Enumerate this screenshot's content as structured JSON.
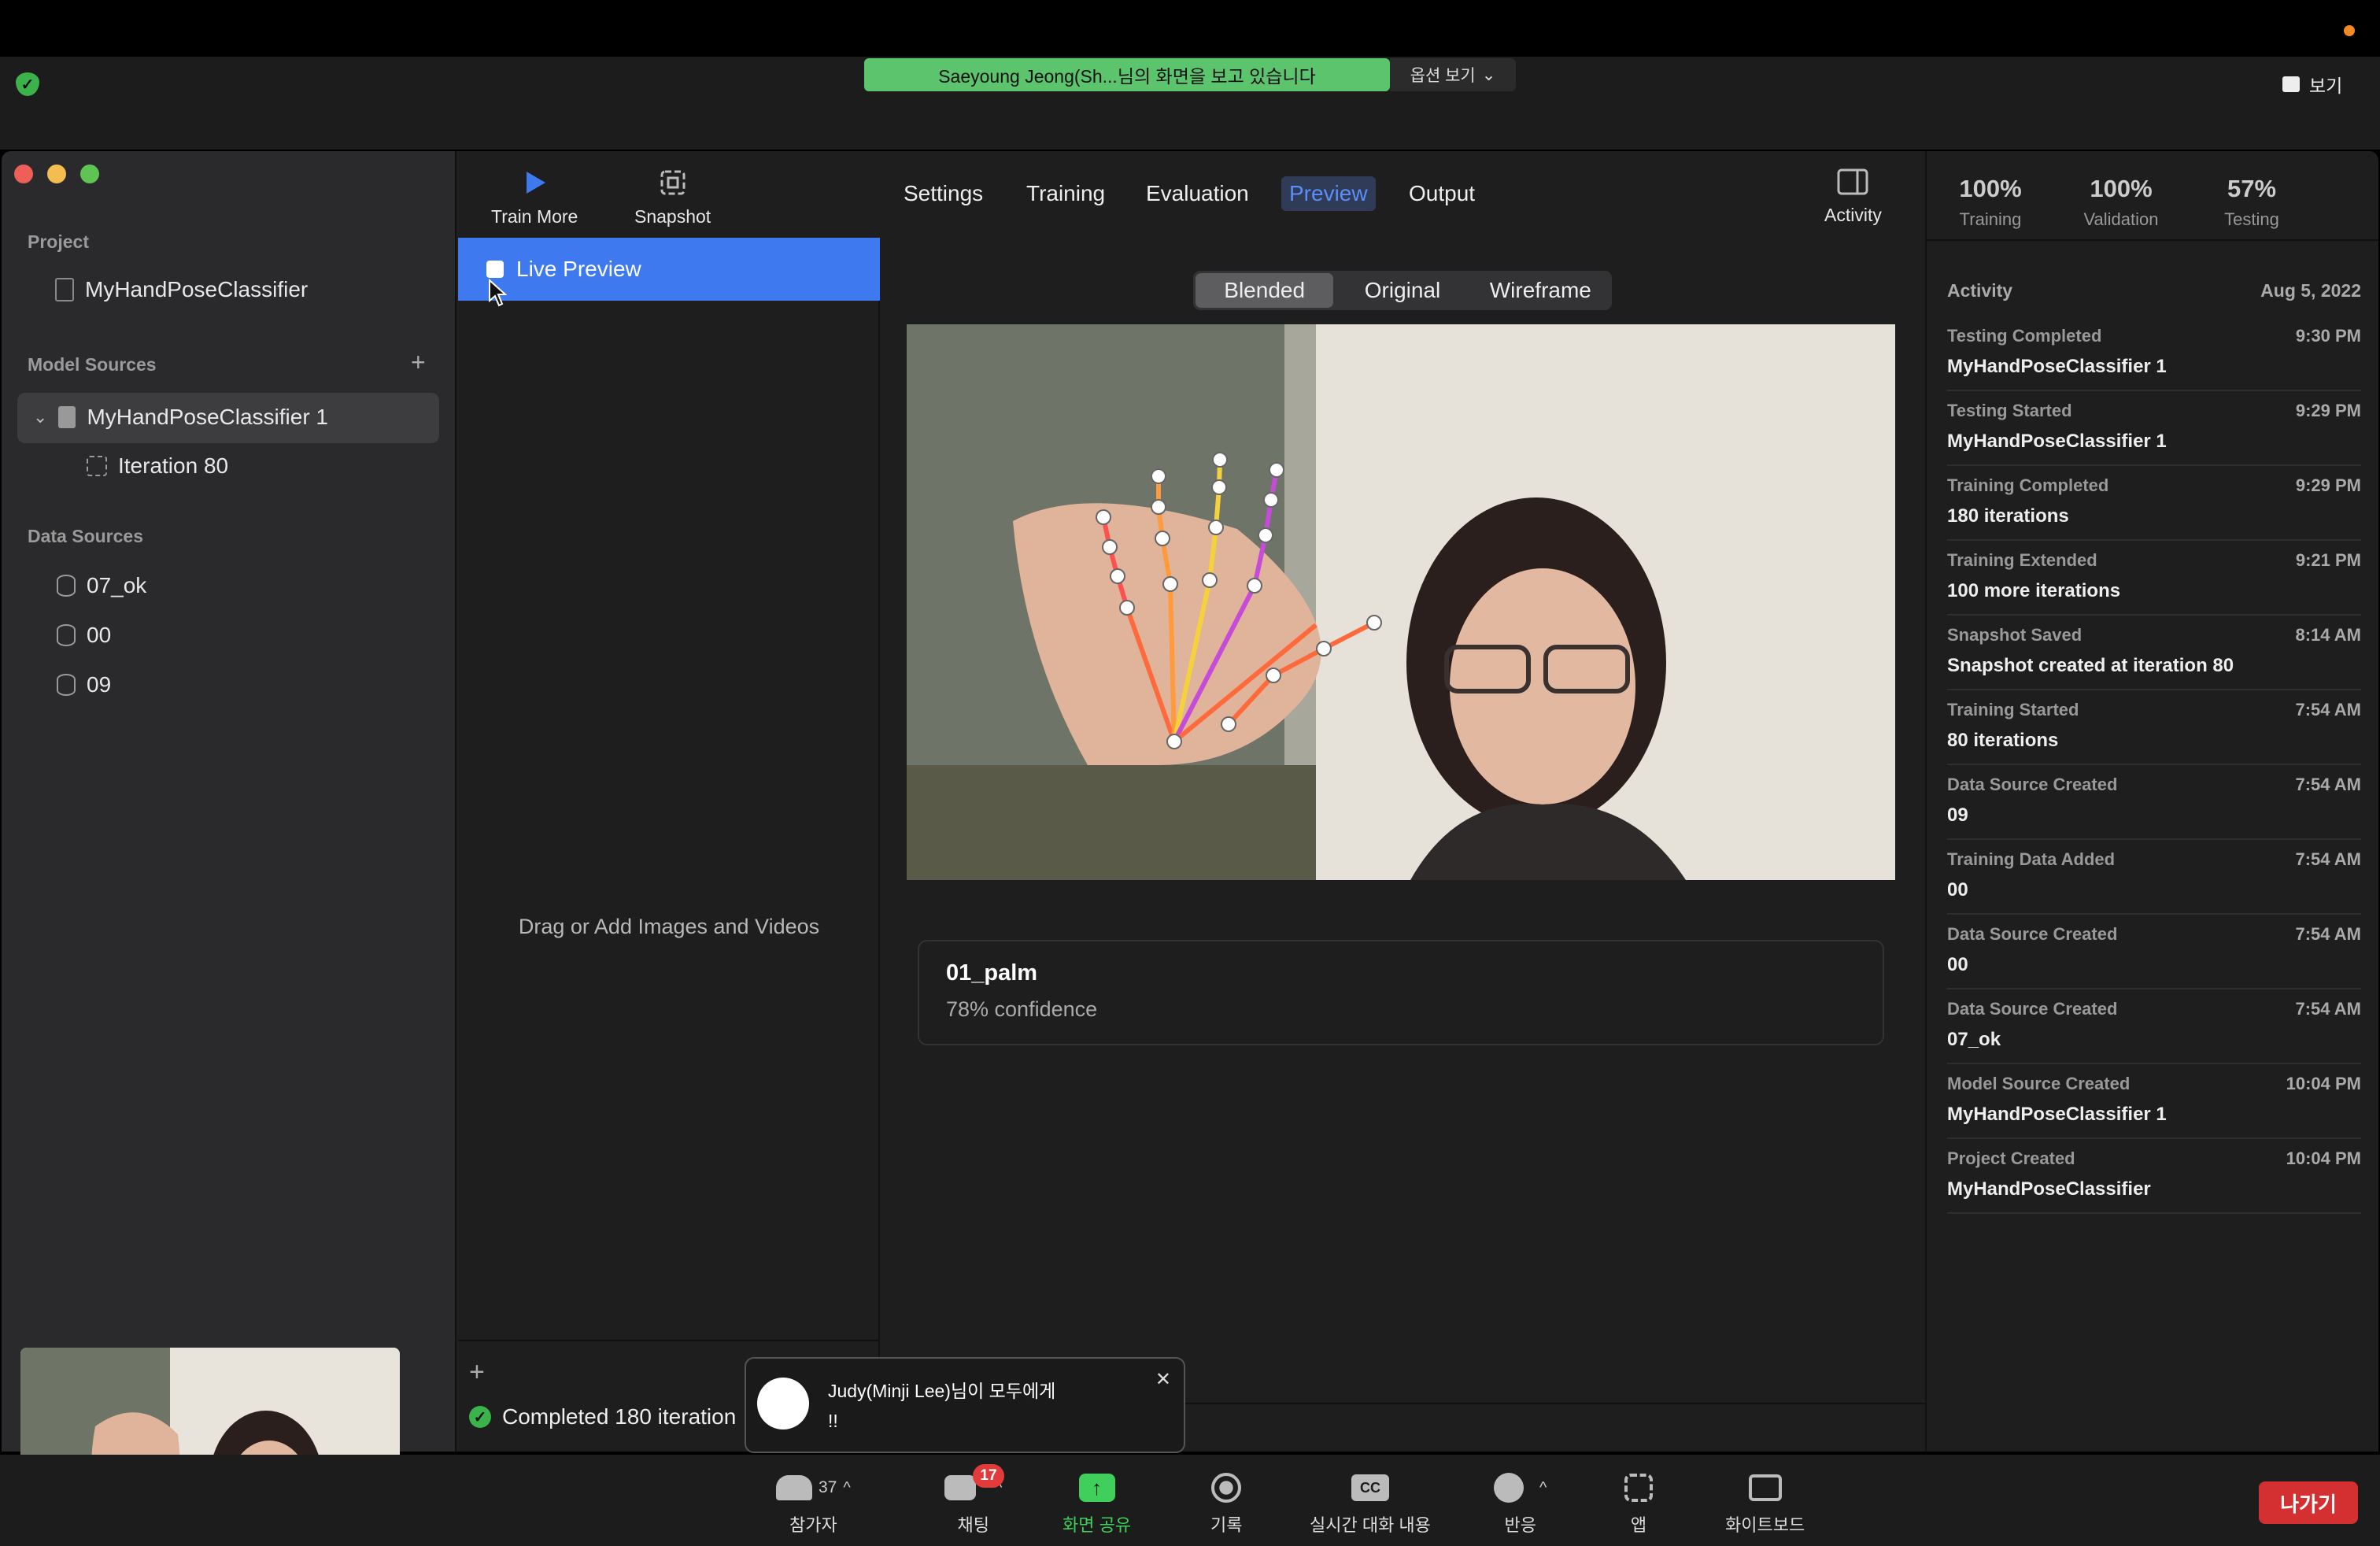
{
  "zoom": {
    "share_banner": "Saeyoung Jeong(Sh...님의 화면을 보고 있습니다",
    "view_options": "옵션 보기",
    "view_button": "보기",
    "chat_toast": {
      "sender": "Judy(Minji Lee)님이 모두에게",
      "message": "!!"
    },
    "bottom_bar": {
      "participants_label": "참가자",
      "participants_count": "37",
      "chat_label": "채팅",
      "chat_badge": "17",
      "share_label": "화면 공유",
      "record_label": "기록",
      "captions_label": "실시간 대화 내용",
      "captions_icon_text": "CC",
      "reactions_label": "반응",
      "apps_label": "앱",
      "whiteboard_label": "화이트보드",
      "leave_label": "나가기"
    },
    "colors": {
      "share_banner": "#5cc46c",
      "leave": "#d43031",
      "share_green": "#3fcf5a"
    }
  },
  "sidebar": {
    "project_heading": "Project",
    "project_name": "MyHandPoseClassifier",
    "model_sources_heading": "Model Sources",
    "model_source": "MyHandPoseClassifier 1",
    "iteration": "Iteration 80",
    "data_sources_heading": "Data Sources",
    "data_sources": [
      "07_ok",
      "00",
      "09"
    ]
  },
  "toolbar": {
    "train_more": "Train More",
    "snapshot": "Snapshot",
    "activity": "Activity",
    "tabs": [
      "Settings",
      "Training",
      "Evaluation",
      "Preview",
      "Output"
    ],
    "selected_tab": "Preview"
  },
  "list": {
    "live_preview": "Live Preview",
    "drag_hint": "Drag or Add Images and Videos",
    "add_icon": "+",
    "status": "Completed 180 iteration"
  },
  "preview": {
    "modes": [
      "Blended",
      "Original",
      "Wireframe"
    ],
    "selected_mode": "Blended",
    "prediction_label": "01_palm",
    "prediction_confidence": "78% confidence"
  },
  "stats": [
    {
      "value": "100%",
      "label": "Training"
    },
    {
      "value": "100%",
      "label": "Validation"
    },
    {
      "value": "57%",
      "label": "Testing"
    }
  ],
  "activity": {
    "heading": "Activity",
    "date": "Aug 5, 2022",
    "items": [
      {
        "title": "Testing Completed",
        "time": "9:30 PM",
        "detail": "MyHandPoseClassifier 1"
      },
      {
        "title": "Testing Started",
        "time": "9:29 PM",
        "detail": "MyHandPoseClassifier 1"
      },
      {
        "title": "Training Completed",
        "time": "9:29 PM",
        "detail": "180 iterations"
      },
      {
        "title": "Training Extended",
        "time": "9:21 PM",
        "detail": "100 more iterations"
      },
      {
        "title": "Snapshot Saved",
        "time": "8:14 AM",
        "detail": "Snapshot created at iteration 80"
      },
      {
        "title": "Training Started",
        "time": "7:54 AM",
        "detail": "80 iterations"
      },
      {
        "title": "Data Source Created",
        "time": "7:54 AM",
        "detail": "09"
      },
      {
        "title": "Training Data Added",
        "time": "7:54 AM",
        "detail": "00"
      },
      {
        "title": "Data Source Created",
        "time": "7:54 AM",
        "detail": "00"
      },
      {
        "title": "Data Source Created",
        "time": "7:54 AM",
        "detail": "07_ok"
      },
      {
        "title": "Model Source Created",
        "time": "10:04 PM",
        "detail": "MyHandPoseClassifier 1"
      },
      {
        "title": "Project Created",
        "time": "10:04 PM",
        "detail": "MyHandPoseClassifier"
      }
    ]
  },
  "colors": {
    "accent": "#3e79f0",
    "selected_tab_text": "#5b8ef7"
  }
}
